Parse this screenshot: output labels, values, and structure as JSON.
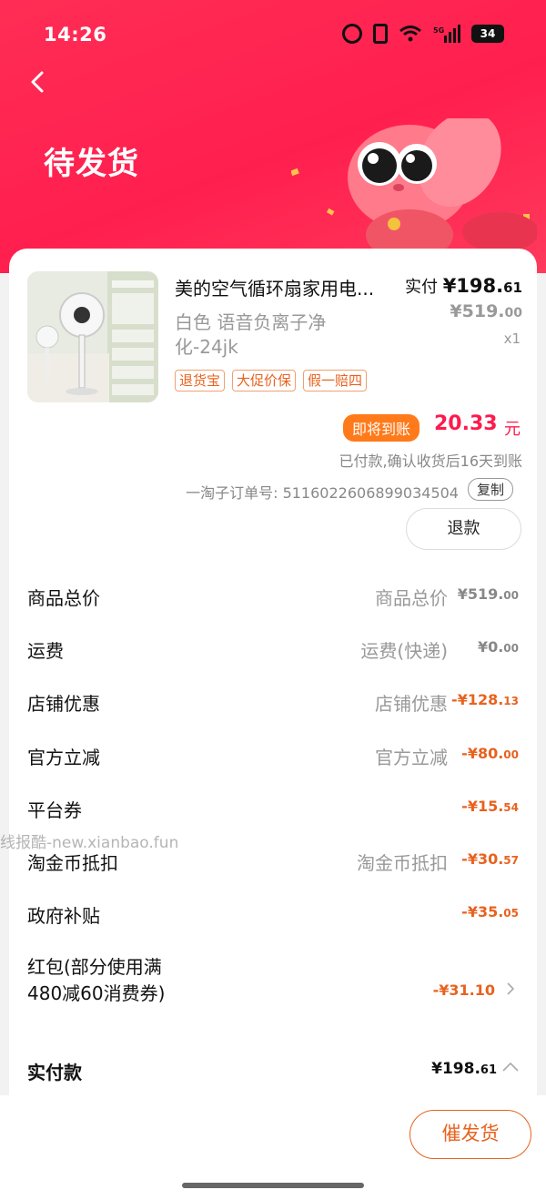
{
  "status_bar": {
    "time": "14:26",
    "battery": "34"
  },
  "header": {
    "title": "待发货"
  },
  "product": {
    "title": "美的空气循环扇家用电...",
    "variant": "白色 语音负离子净化-24jk",
    "tags": [
      "退货宝",
      "大促价保",
      "假一赔四"
    ],
    "paid_prefix": "实付",
    "paid_int": "¥198.",
    "paid_dec": "61",
    "orig_int": "¥519.",
    "orig_dec": "00",
    "qty": "x1"
  },
  "arrival": {
    "badge": "即将到账",
    "amount": "20.33",
    "unit": "元",
    "note": "已付款,确认收货后16天到账"
  },
  "order": {
    "number_text": "一淘子订单号: 5116022606899034504",
    "copy_label": "复制"
  },
  "refund_label": "退款",
  "costs": [
    {
      "label": "商品总价",
      "sub": "商品总价",
      "val_int": "¥519.",
      "val_dec": "00",
      "red": false
    },
    {
      "label": "运费",
      "sub": "运费(快递)",
      "val_int": "¥0.",
      "val_dec": "00",
      "red": false
    },
    {
      "label": "店铺优惠",
      "sub": "店铺优惠",
      "val_int": "-¥128.",
      "val_dec": "13",
      "red": true
    },
    {
      "label": "官方立减",
      "sub": "官方立减",
      "val_int": "-¥80.",
      "val_dec": "00",
      "red": true
    },
    {
      "label": "平台券",
      "sub": "",
      "val_int": "-¥15.",
      "val_dec": "54",
      "red": true
    },
    {
      "label": "淘金币抵扣",
      "sub": "淘金币抵扣",
      "val_int": "-¥30.",
      "val_dec": "57",
      "red": true
    },
    {
      "label": "政府补贴",
      "sub": "",
      "val_int": "-¥35.",
      "val_dec": "05",
      "red": true
    }
  ],
  "redpack": {
    "label": "红包(部分使用满480减60消费券)",
    "val": "-¥31.10"
  },
  "total": {
    "label": "实付款",
    "val_int": "¥198.",
    "val_dec": "61"
  },
  "watermark": "线报酷-new.xianbao.fun",
  "bottom": {
    "urge_label": "催发货"
  },
  "colors": {
    "brand": "#ff2d55",
    "accent": "#e8621e",
    "arrive": "#ff1a4b"
  }
}
